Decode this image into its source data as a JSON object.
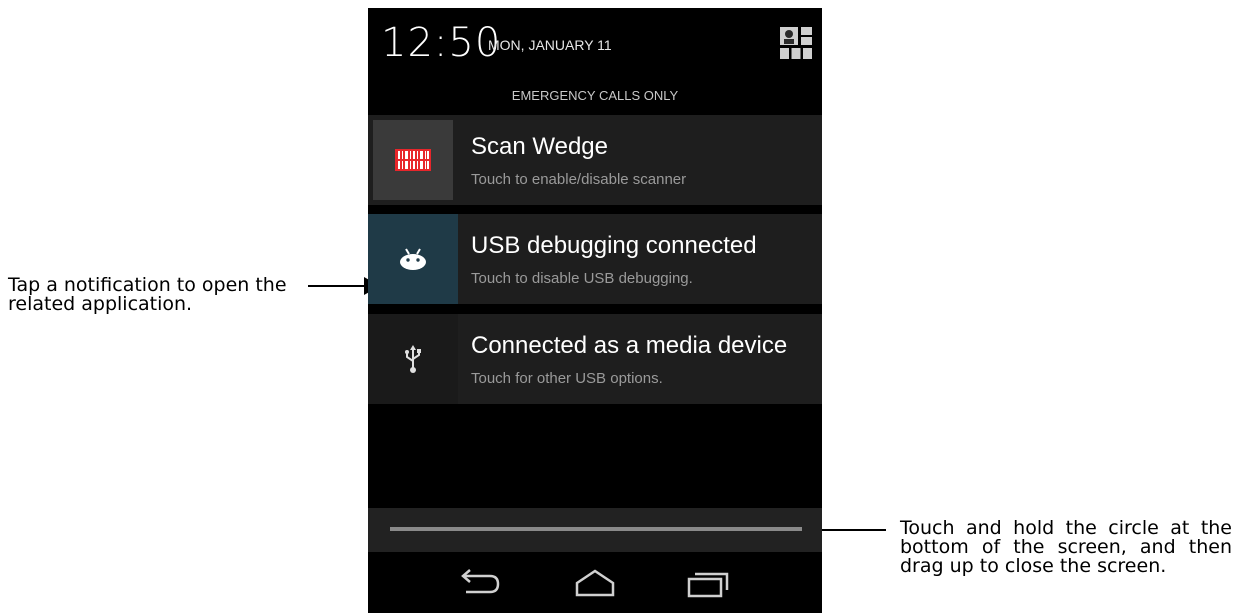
{
  "status_bar": {
    "time": "12:50",
    "date": "MON, JANUARY 11",
    "carrier_text": "EMERGENCY CALLS ONLY",
    "quick_settings_icon": "quick-settings-icon"
  },
  "notifications": [
    {
      "title": "Scan Wedge",
      "subtitle": "Touch to enable/disable scanner",
      "icon": "barcode-icon"
    },
    {
      "title": "USB debugging connected",
      "subtitle": "Touch to disable USB debugging.",
      "icon": "android-icon"
    },
    {
      "title": "Connected as a media device",
      "subtitle": "Touch for other USB options.",
      "icon": "usb-icon"
    }
  ],
  "navigation": {
    "buttons": [
      "back-icon",
      "home-icon",
      "recents-icon"
    ]
  },
  "callouts": {
    "left": "Tap a notification to open the related application.",
    "right": "Touch and hold the circle at the bottom of the screen, and then drag up to close the screen."
  },
  "colors": {
    "panel_bg": "#000000",
    "notification_bg": "#1e1e1e",
    "usb_debug_icon_bg": "#1f3a47",
    "scan_icon_bg": "#3a3a3a",
    "barcode_red": "#e8262b"
  }
}
